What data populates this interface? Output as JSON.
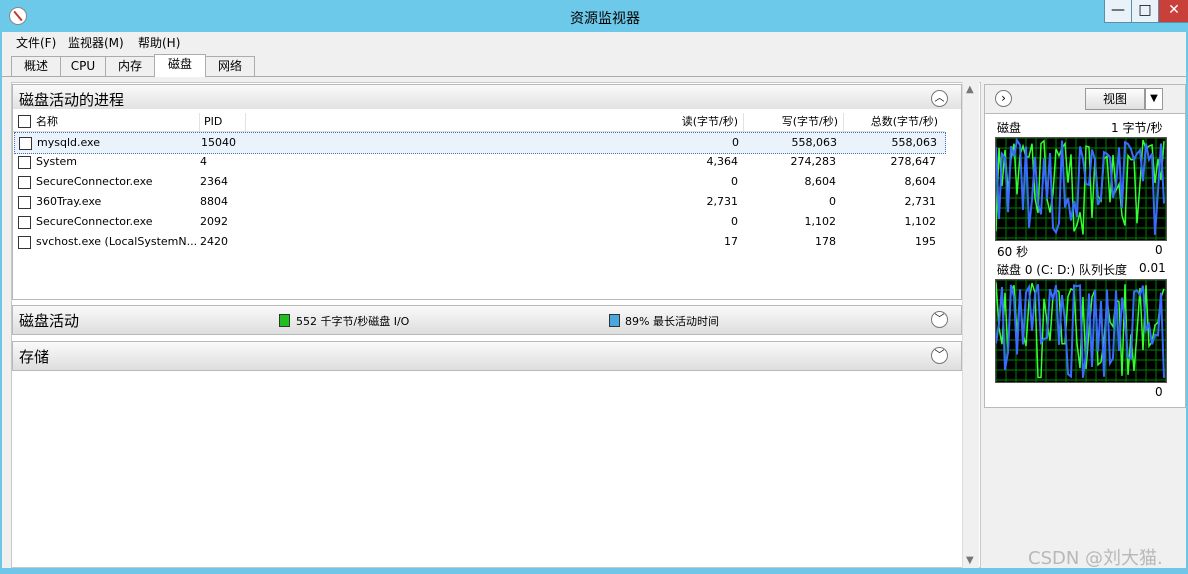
{
  "window": {
    "title": "资源监视器",
    "min_glyph": "—",
    "max_glyph": "□",
    "close_glyph": "✕"
  },
  "menu": [
    "文件(F)",
    "监视器(M)",
    "帮助(H)"
  ],
  "tabs": [
    "概述",
    "CPU",
    "内存",
    "磁盘",
    "网络"
  ],
  "active_tab": "磁盘",
  "processes_section": {
    "title": "磁盘活动的进程",
    "collapse_glyph": "︿",
    "columns": [
      "名称",
      "PID",
      "读(字节/秒)",
      "写(字节/秒)",
      "总数(字节/秒)"
    ],
    "rows": [
      {
        "name": "mysqld.exe",
        "pid": "15040",
        "read": "0",
        "write": "558,063",
        "total": "558,063"
      },
      {
        "name": "System",
        "pid": "4",
        "read": "4,364",
        "write": "274,283",
        "total": "278,647"
      },
      {
        "name": "SecureConnector.exe",
        "pid": "2364",
        "read": "0",
        "write": "8,604",
        "total": "8,604"
      },
      {
        "name": "360Tray.exe",
        "pid": "8804",
        "read": "2,731",
        "write": "0",
        "total": "2,731"
      },
      {
        "name": "SecureConnector.exe",
        "pid": "2092",
        "read": "0",
        "write": "1,102",
        "total": "1,102"
      },
      {
        "name": "svchost.exe (LocalSystemN...",
        "pid": "2420",
        "read": "17",
        "write": "178",
        "total": "195"
      }
    ]
  },
  "disk_activity_section": {
    "title": "磁盘活动",
    "io_text": "552 千字节/秒磁盘 I/O",
    "io_color": "#1fbf1f",
    "active_text": "89% 最长活动时间",
    "active_color": "#4aa8e0",
    "expand_glyph": "﹀"
  },
  "storage_section": {
    "title": "存储",
    "expand_glyph": "﹀"
  },
  "right_panel": {
    "nav_glyph": "›",
    "view_label": "视图",
    "view_drop_glyph": "▼",
    "graph1": {
      "title": "磁盘",
      "scale": "1 字节/秒",
      "time_label": "60 秒",
      "min_label": "0"
    },
    "graph2": {
      "title": "磁盘 0 (C: D:) 队列长度",
      "scale": "0.01",
      "min_label": "0"
    },
    "colors": {
      "grid": "#008000",
      "green_series": "#33ff33",
      "blue_series": "#3a6bff"
    }
  },
  "watermark": "CSDN @刘大猫."
}
